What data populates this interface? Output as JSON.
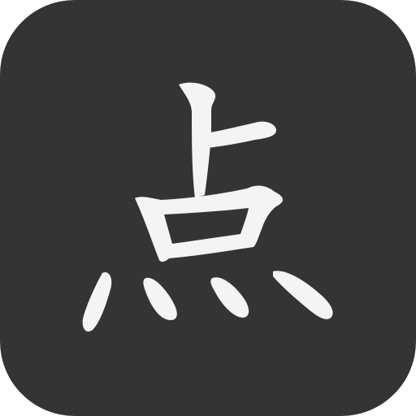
{
  "icon": {
    "character": "点",
    "background_color": "#343434",
    "glyph_color": "#f4f4f4"
  }
}
